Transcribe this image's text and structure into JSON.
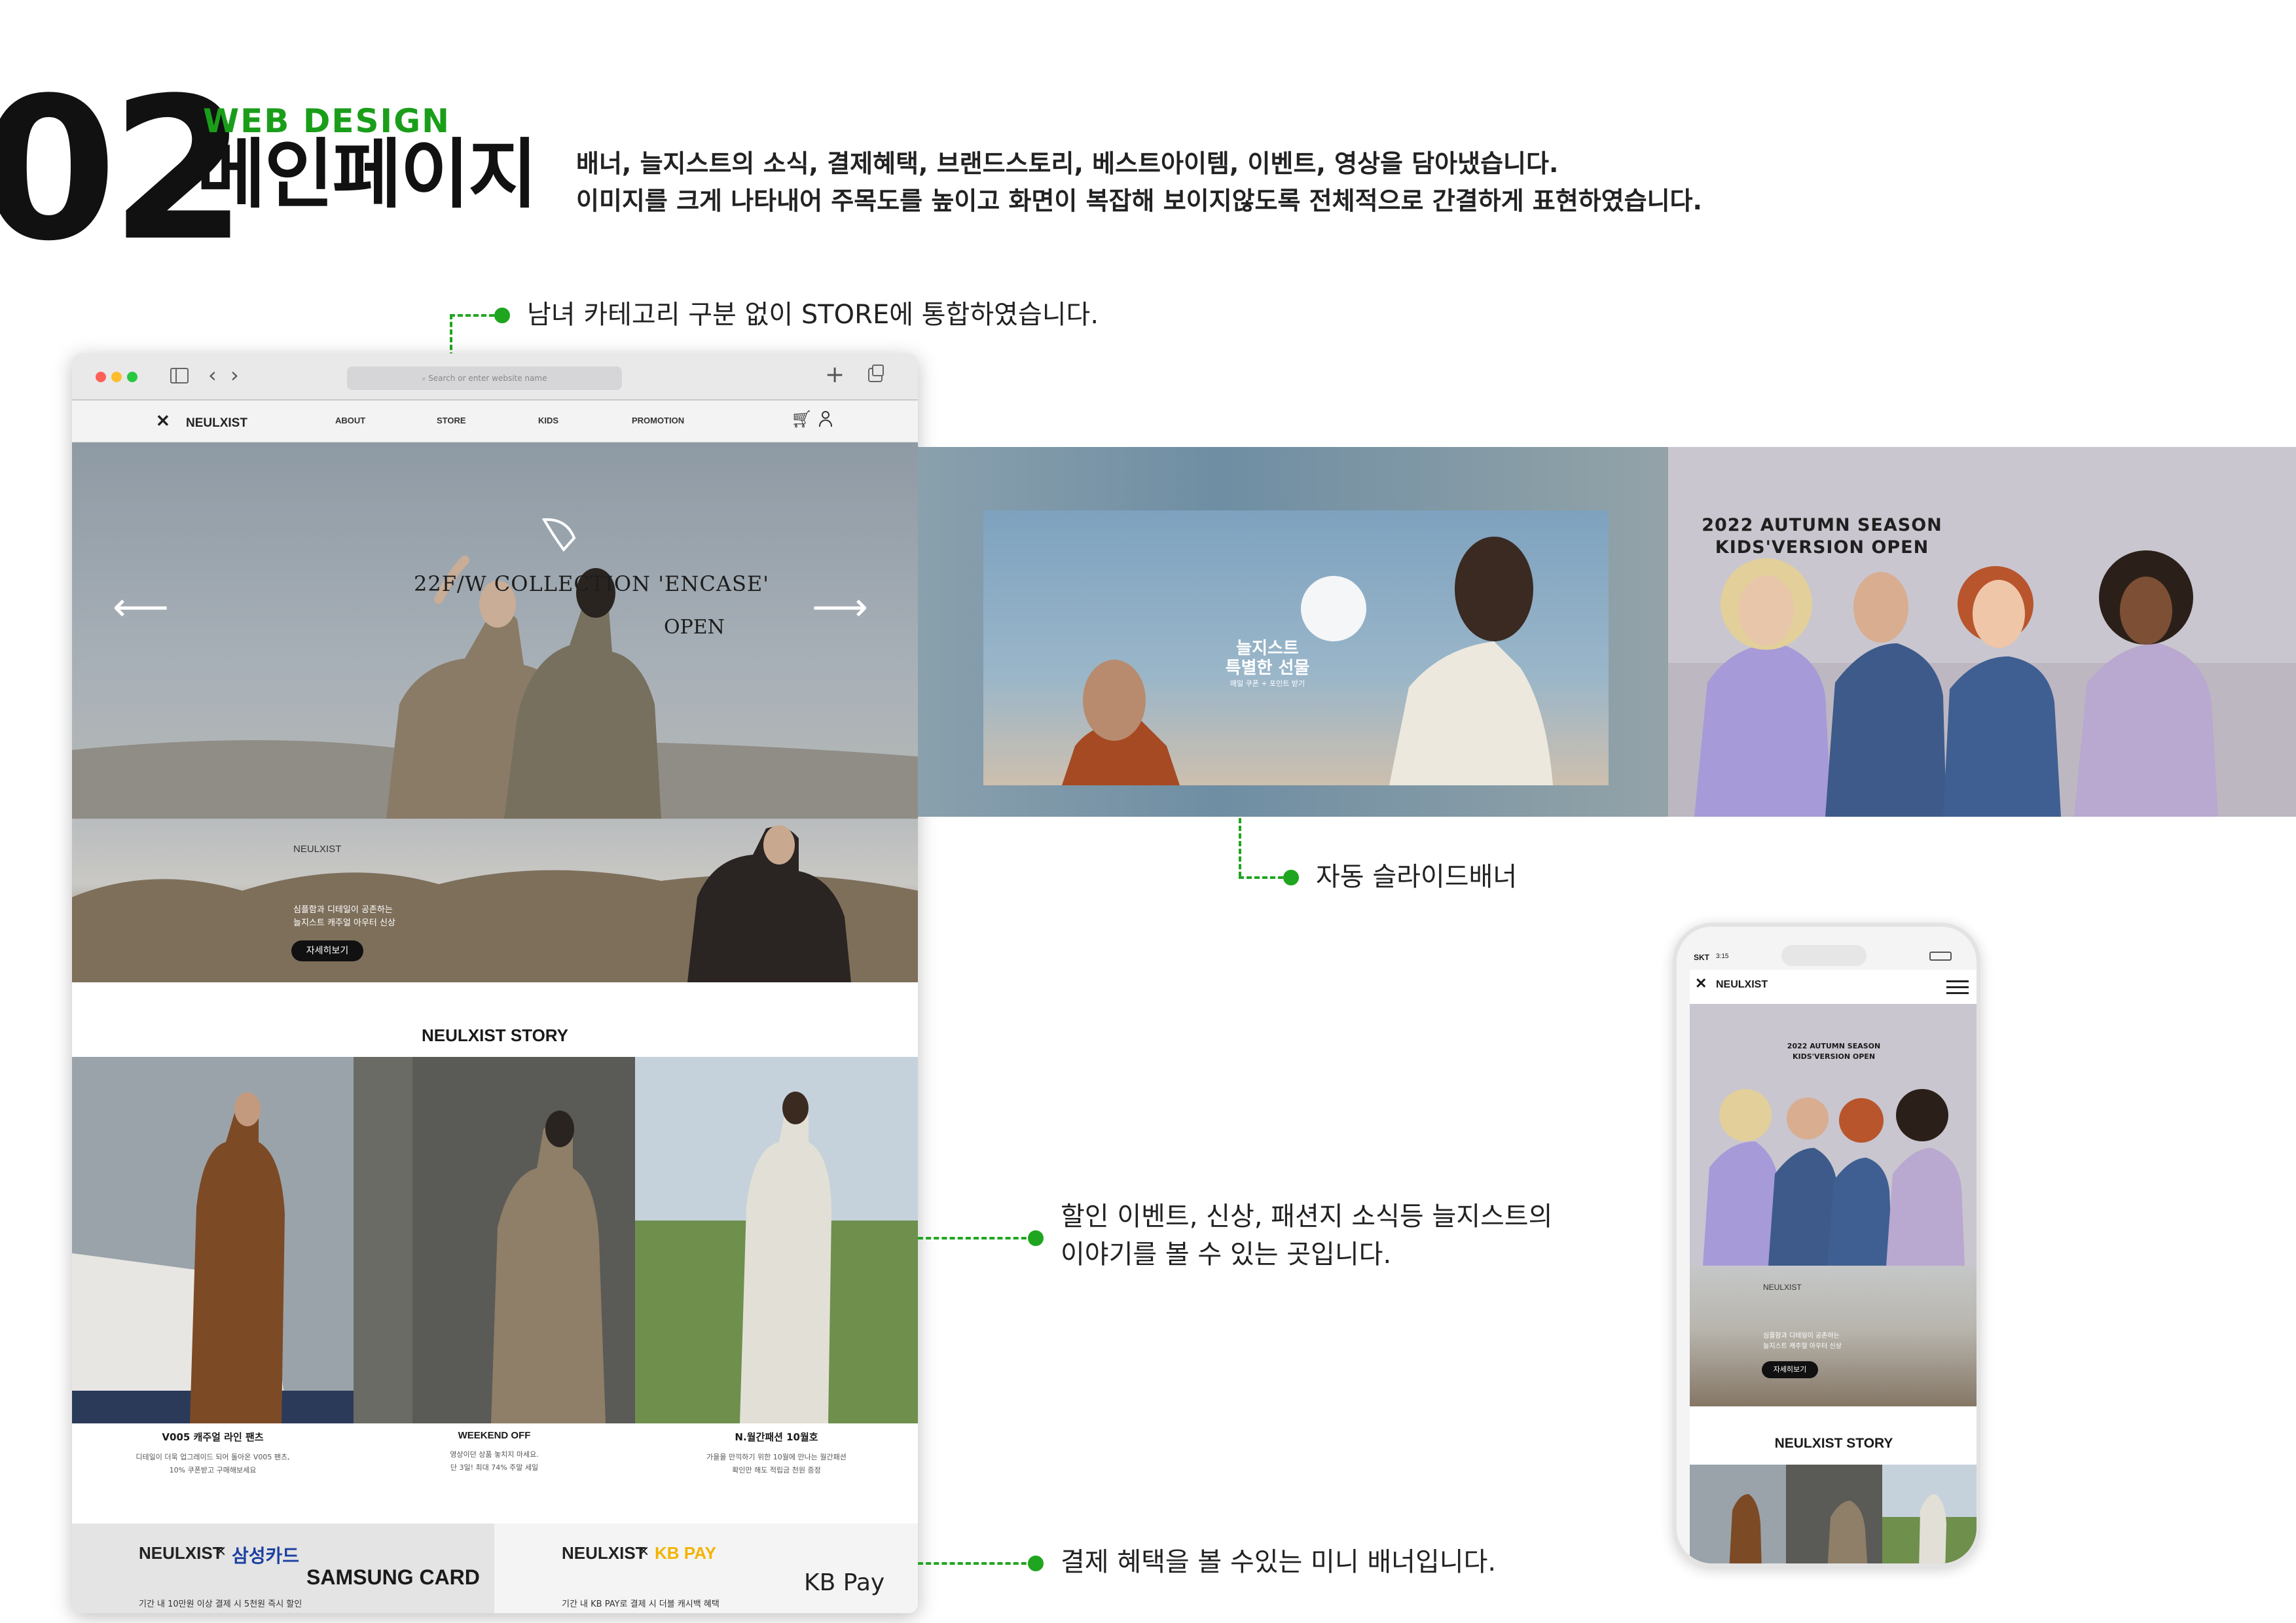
{
  "header": {
    "number": "02",
    "subtitle": "WEB DESIGN",
    "title": "메인페이지",
    "desc_line1": "배너, 늘지스트의 소식, 결제혜택, 브랜드스토리, 베스트아이템, 이벤트, 영상을 담아냈습니다.",
    "desc_line2": "이미지를 크게 나타내어 주목도를 높이고 화면이 복잡해 보이지않도록 전체적으로 간결하게 표현하였습니다."
  },
  "callouts": {
    "store": "남녀 카테고리 구분 없이 STORE에 통합하였습니다.",
    "slide": "자동 슬라이드배너",
    "story_line1": "할인 이벤트, 신상, 패션지 소식등 늘지스트의",
    "story_line2": "이야기를 볼 수 있는 곳입니다.",
    "payment": "결제 혜택을 볼 수있는 미니 배너입니다."
  },
  "browser": {
    "url_placeholder": "Search or enter website name",
    "logo": "NEULXIST",
    "nav": [
      "ABOUT",
      "STORE",
      "KIDS",
      "PROMOTION"
    ],
    "hero_title": "22F/W COLLECTION 'ENCASE'",
    "hero_sub": "OPEN",
    "banner2_brand": "NEULXIST",
    "banner2_line1": "심플함과 디테일이 공존하는",
    "banner2_line2": "늘지스트 캐주얼 아우터 신상",
    "banner2_button": "자세히보기",
    "story_title": "NEULXIST STORY",
    "stories": [
      {
        "title": "V005 캐주얼 라인 팬츠",
        "line1": "디테일이 더욱 업그레이드 되어 돌아온 V005 팬츠,",
        "line2": "10% 쿠폰받고 구매해보세요"
      },
      {
        "title": "WEEKEND OFF",
        "line1": "영상이던 상품 놓치지 마세요.",
        "line2": "단 3일! 최대 74% 주말 세일"
      },
      {
        "title": "N.월간패션 10월호",
        "line1": "가을을 만끽하기 위한 10월에 만나는 월간패션",
        "line2": "확인만 해도 적립금 천원 증정"
      }
    ],
    "cards": [
      {
        "brand": "NEULXIST",
        "x": "×",
        "partner": "삼성카드",
        "partner_color": "#1b3fa0",
        "logo": "SAMSUNG CARD",
        "note": "기간 내 10만원 이상 결제 시 5천원 즉시 할인"
      },
      {
        "brand": "NEULXIST",
        "x": "×",
        "partner": "KB PAY",
        "partner_color": "#f2b400",
        "logo": "KB Pay",
        "note": "기간 내 KB PAY로 결제 시 더블 캐시백 혜택"
      }
    ]
  },
  "slides": {
    "gift_title1": "늘지스트",
    "gift_title2": "특별한 선물",
    "gift_sub": "매일 쿠폰 + 포인트 받기",
    "kids_line1": "2022 AUTUMN SEASON",
    "kids_line2": "KIDS'VERSION OPEN"
  },
  "phone": {
    "carrier": "SKT",
    "time": "3:15",
    "logo": "NEULXIST",
    "kids_line1": "2022 AUTUMN SEASON",
    "kids_line2": "KIDS'VERSION OPEN",
    "brand": "NEULXIST",
    "line1": "심플함과 디테일이 공존하는",
    "line2": "늘지스트 캐주얼 아우터 신상",
    "button": "자세히보기",
    "story_title": "NEULXIST STORY"
  },
  "colors": {
    "accent": "#1fa51f",
    "samsung": "#1b3fa0",
    "kbpay": "#f2b400"
  }
}
